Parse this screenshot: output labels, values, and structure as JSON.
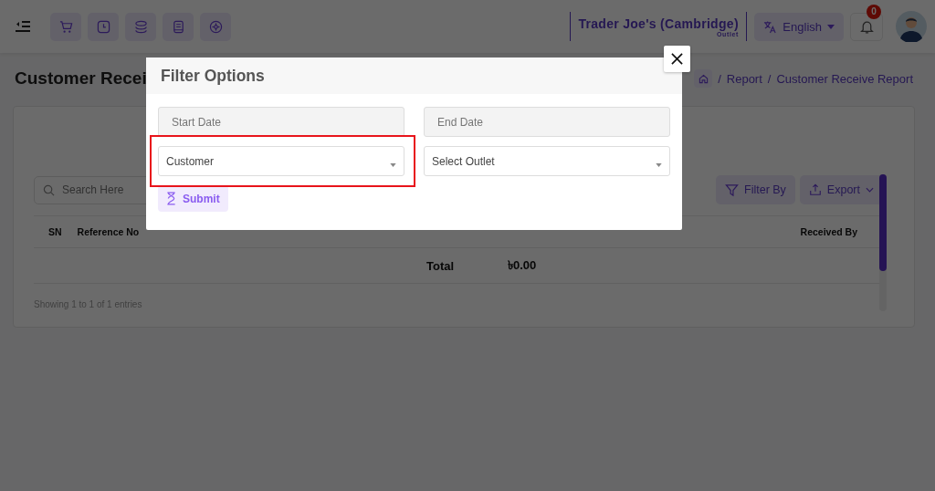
{
  "header": {
    "outlet": {
      "name": "Trader Joe's (Cambridge)",
      "label": "Outlet"
    },
    "language": "English",
    "notifications": {
      "count": "0"
    }
  },
  "page": {
    "title": "Customer Recei",
    "breadcrumb": [
      {
        "separator": "/",
        "label": "Report"
      },
      {
        "separator": "/",
        "label": "Customer Receive Report"
      }
    ]
  },
  "toolbar": {
    "search": {
      "placeholder": "Search Here"
    },
    "filter_button": "Filter By",
    "export_button": "Export"
  },
  "table": {
    "columns": [
      {
        "label": "SN",
        "kind": "left"
      },
      {
        "label": "Reference No",
        "kind": "left"
      },
      {
        "label": "Received By",
        "kind": "right"
      }
    ],
    "total_row": {
      "label": "Total",
      "amount": "৳0.00"
    },
    "footer": "Showing 1 to 1 of 1 entries"
  },
  "modal": {
    "title": "Filter Options",
    "fields": [
      {
        "kind": "date",
        "placeholder": "Start Date",
        "disabled": true,
        "highlighted": false
      },
      {
        "kind": "date",
        "placeholder": "End Date",
        "disabled": true,
        "highlighted": false
      },
      {
        "kind": "select",
        "value": "Customer",
        "disabled": false,
        "highlighted": true
      },
      {
        "kind": "select",
        "value": "Select Outlet",
        "disabled": false,
        "highlighted": false
      }
    ],
    "submit": "Submit"
  }
}
